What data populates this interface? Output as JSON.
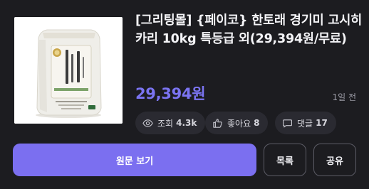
{
  "product": {
    "title": "[그리팅몰] {페이코} 한토래 경기미 고시히카리 10kg 특등급 외(29,394원/무료)",
    "price": "29,394원",
    "posted_time": "1일 전",
    "image": {
      "bag_label_top": "경기미",
      "bag_label_main": "고시히카리",
      "bag_label_bottom": "한토래"
    }
  },
  "stats": {
    "views_label": "조회",
    "views_count": "4.3k",
    "likes_label": "좋아요",
    "likes_count": "8",
    "comments_label": "댓글",
    "comments_count": "17"
  },
  "icons": {
    "views": "eye-icon",
    "likes": "thumbs-up-icon",
    "comments": "comment-icon"
  },
  "actions": {
    "view_original": "원문 보기",
    "list": "목록",
    "share": "공유"
  },
  "colors": {
    "accent": "#7b6ff0",
    "price": "#7b74f2",
    "background": "#1c1c20",
    "chip_background": "#2a2a31"
  }
}
